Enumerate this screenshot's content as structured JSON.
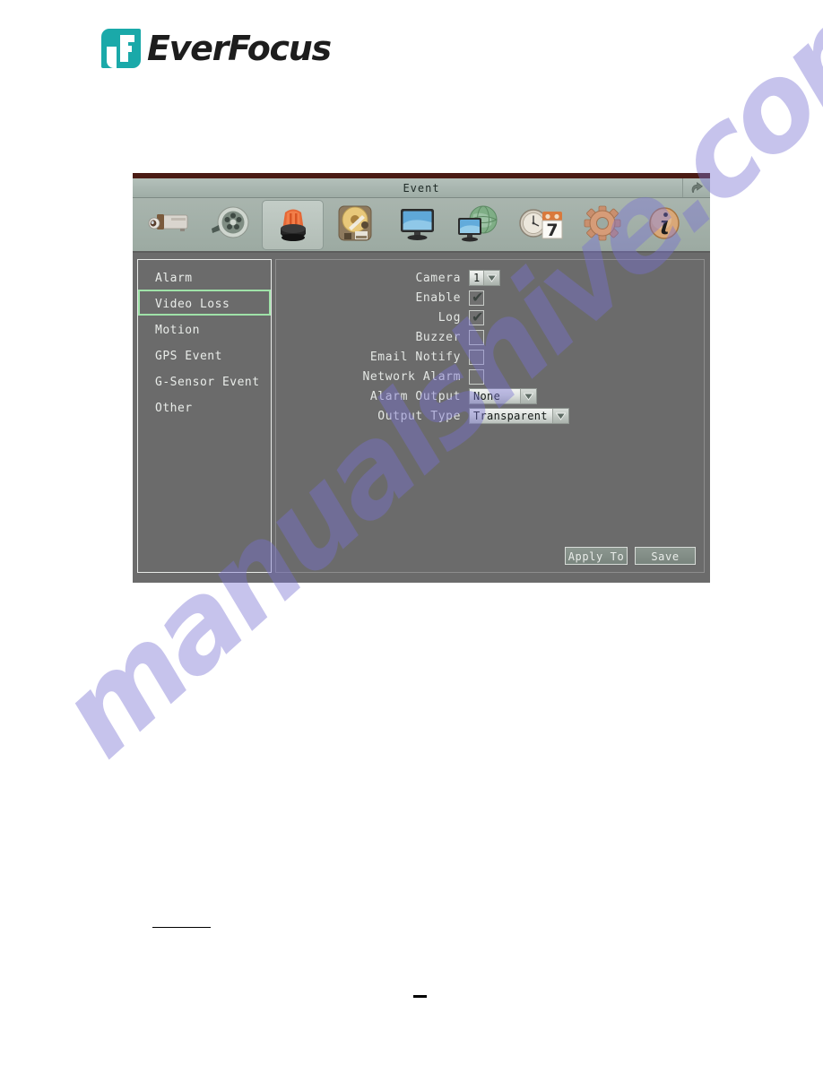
{
  "brand": {
    "name": "EverFocus",
    "mark_color": "#1aa9a9"
  },
  "window": {
    "title": "Event",
    "back_icon": "back-arrow-icon",
    "accent_top_color": "#4b1c14",
    "panel_bg": "#6b6b6b",
    "selection_color": "#9fe2a8"
  },
  "toolbar": {
    "items": [
      {
        "icon": "camera-icon",
        "selected": false
      },
      {
        "icon": "record-reel-icon",
        "selected": false
      },
      {
        "icon": "alarm-siren-icon",
        "selected": true
      },
      {
        "icon": "hard-disk-icon",
        "selected": false
      },
      {
        "icon": "display-monitor-icon",
        "selected": false
      },
      {
        "icon": "network-globe-icon",
        "selected": false
      },
      {
        "icon": "clock-calendar-icon",
        "selected": false
      },
      {
        "icon": "gear-settings-icon",
        "selected": false
      },
      {
        "icon": "info-icon",
        "selected": false
      }
    ]
  },
  "sidebar": {
    "items": [
      {
        "label": "Alarm",
        "selected": false
      },
      {
        "label": "Video Loss",
        "selected": true
      },
      {
        "label": "Motion",
        "selected": false
      },
      {
        "label": "GPS Event",
        "selected": false
      },
      {
        "label": "G-Sensor Event",
        "selected": false
      },
      {
        "label": "Other",
        "selected": false
      }
    ]
  },
  "form": {
    "camera": {
      "label": "Camera",
      "value": "1"
    },
    "enable": {
      "label": "Enable",
      "checked": true,
      "tick": "✔"
    },
    "log": {
      "label": "Log",
      "checked": true,
      "tick": "✔"
    },
    "buzzer": {
      "label": "Buzzer",
      "checked": false,
      "tick": ""
    },
    "email_notify": {
      "label": "Email Notify",
      "checked": false,
      "tick": ""
    },
    "network_alarm": {
      "label": "Network Alarm",
      "checked": false,
      "tick": ""
    },
    "alarm_output": {
      "label": "Alarm Output",
      "value": "None"
    },
    "output_type": {
      "label": "Output Type",
      "value": "Transparent"
    }
  },
  "buttons": {
    "apply_to": "Apply To",
    "save": "Save"
  },
  "watermark": {
    "text": "manualshive.com"
  }
}
